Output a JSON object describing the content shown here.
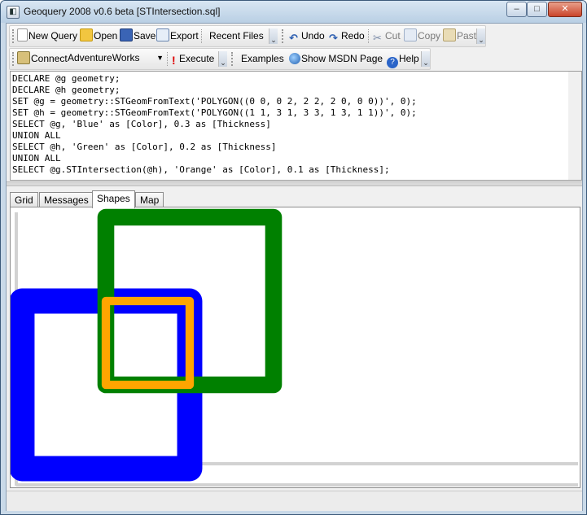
{
  "window": {
    "title": "Geoquery 2008 v0.6 beta [STIntersection.sql]",
    "app_icon": "sql-file-icon",
    "buttons": {
      "minimize": "–",
      "maximize": "□",
      "close": "✕"
    }
  },
  "toolbar1": {
    "new_query": "New Query",
    "open": "Open",
    "save": "Save",
    "export": "Export",
    "recent_files": "Recent Files",
    "undo": "Undo",
    "redo": "Redo",
    "cut": "Cut",
    "copy": "Copy",
    "paste": "Paste"
  },
  "toolbar2": {
    "connect": "Connect",
    "database": "AdventureWorks",
    "execute": "Execute",
    "examples": "Examples",
    "show_msdn": "Show MSDN Page",
    "help": "Help"
  },
  "editor": {
    "lines": [
      "DECLARE @g geometry;",
      "DECLARE @h geometry;",
      "SET @g = geometry::STGeomFromText('POLYGON((0 0, 0 2, 2 2, 2 0, 0 0))', 0);",
      "SET @h = geometry::STGeomFromText('POLYGON((1 1, 3 1, 3 3, 1 3, 1 1))', 0);",
      "SELECT @g, 'Blue' as [Color], 0.3 as [Thickness]",
      "UNION ALL",
      "SELECT @h, 'Green' as [Color], 0.2 as [Thickness]",
      "UNION ALL",
      "SELECT @g.STIntersection(@h), 'Orange' as [Color], 0.1 as [Thickness];"
    ]
  },
  "tabs": [
    "Grid",
    "Messages",
    "Shapes",
    "Map"
  ],
  "active_tab": "Shapes",
  "shapes": [
    {
      "name": "g",
      "color": "#0000ff",
      "thickness": 0.3,
      "polygon": [
        [
          0,
          0
        ],
        [
          0,
          2
        ],
        [
          2,
          2
        ],
        [
          2,
          0
        ],
        [
          0,
          0
        ]
      ]
    },
    {
      "name": "h",
      "color": "#008000",
      "thickness": 0.2,
      "polygon": [
        [
          1,
          1
        ],
        [
          3,
          1
        ],
        [
          3,
          3
        ],
        [
          1,
          3
        ],
        [
          1,
          1
        ]
      ]
    },
    {
      "name": "intersection",
      "color": "#ffa500",
      "thickness": 0.1,
      "polygon": [
        [
          1,
          1
        ],
        [
          1,
          2
        ],
        [
          2,
          2
        ],
        [
          2,
          1
        ],
        [
          1,
          1
        ]
      ]
    }
  ],
  "colors": {
    "titlebar": "#c9d9e8",
    "blue": "#0000ff",
    "green": "#008000",
    "orange": "#ffa500"
  }
}
